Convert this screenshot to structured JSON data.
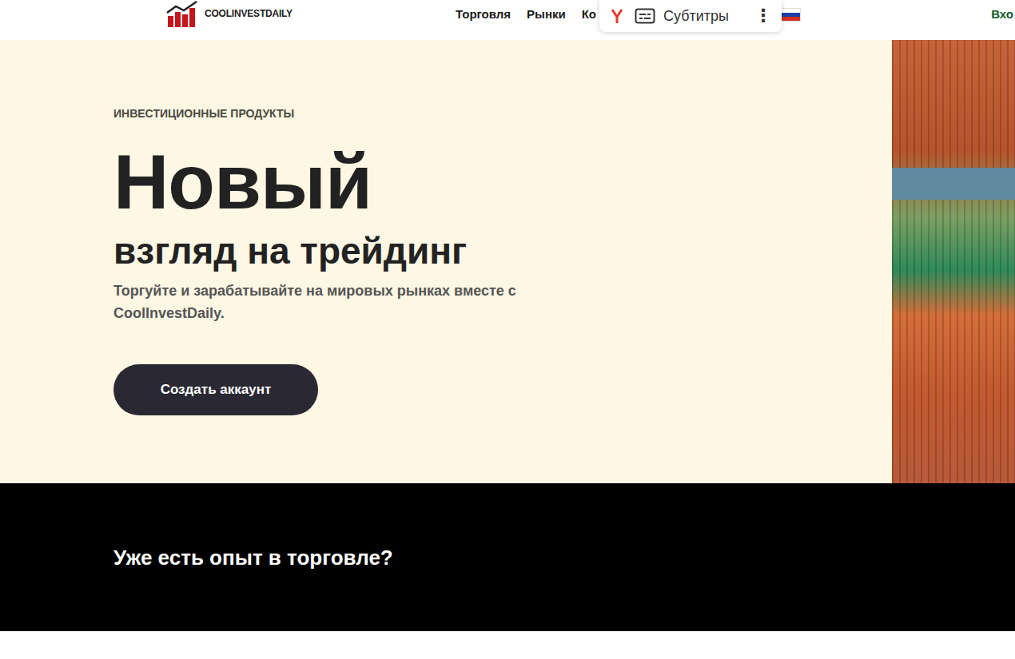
{
  "logo": {
    "text": "COOLINVESTDAILY"
  },
  "nav": {
    "items": [
      "Торговля",
      "Рынки",
      "Ко"
    ],
    "login": "Вхо"
  },
  "overlay": {
    "label": "Субтитры",
    "more": "⋮"
  },
  "hero": {
    "eyebrow": "ИНВЕСТИЦИОННЫЕ ПРОДУКТЫ",
    "title": "Новый",
    "subtitle": "взгляд на трейдинг",
    "text": "Торгуйте и зарабатывайте на мировых рынках вместе с CoolInvestDaily.",
    "button": "Создать аккаунт"
  },
  "experience": {
    "title": "Уже есть опыт в торговле?"
  }
}
